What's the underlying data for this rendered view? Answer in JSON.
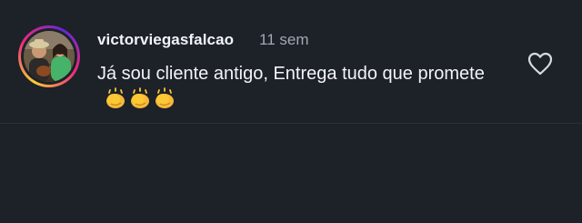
{
  "comment": {
    "username": "victorviegasfalcao",
    "time_ago": "11 sem",
    "text": "Já sou cliente antigo, Entrega tudo que promete",
    "emoji_icon": "clapping-hands-icon",
    "emoji_count": 3,
    "liked": false
  },
  "colors": {
    "background": "#1d2128",
    "text": "#f2f4f7",
    "muted": "#a3a8b1"
  }
}
